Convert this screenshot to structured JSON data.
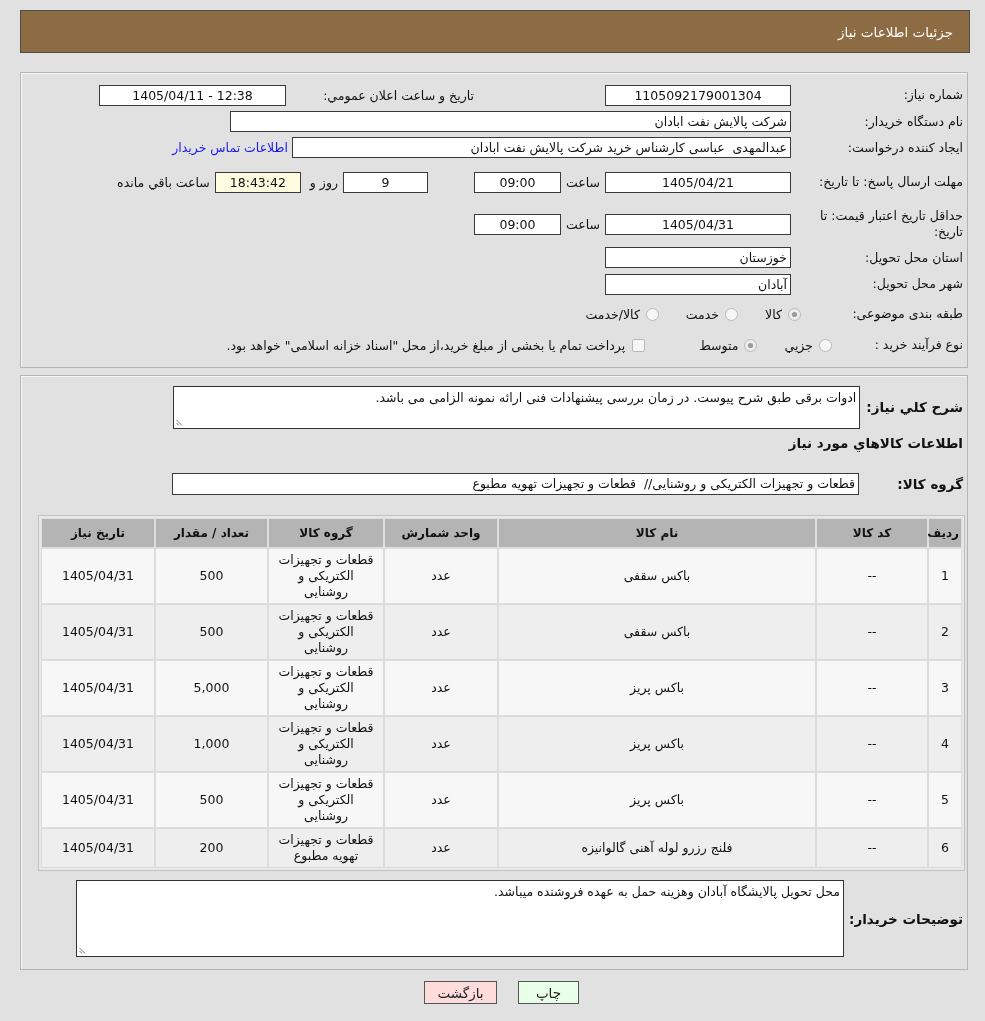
{
  "header": {
    "title": "جزئیات اطلاعات نیاز"
  },
  "details": {
    "need_number": {
      "label": "شماره نیاز:",
      "value": "1105092179001304"
    },
    "announcement": {
      "label": "تاریخ و ساعت اعلان عمومي:",
      "value": "1405/04/11 - 12:38"
    },
    "buyer_org": {
      "label": "نام دستگاه خریدار:",
      "value": "شرکت پالایش نفت ابادان"
    },
    "requester": {
      "label": "ایجاد کننده درخواست:",
      "value": "عبدالمهدی  عباسی کارشناس خرید شرکت پالایش نفت ابادان",
      "contact_link": "اطلاعات تماس خریدار"
    },
    "reply_deadline": {
      "label": "مهلت ارسال پاسخ: تا تاریخ:",
      "date": "1405/04/21",
      "time_label": "ساعت",
      "time": "09:00",
      "days": "9",
      "days_label": "روز و",
      "remaining": "18:43:42",
      "remaining_label": "ساعت باقي مانده"
    },
    "price_validity": {
      "label": "حداقل تاریخ اعتبار قیمت: تا تاریخ:",
      "date": "1405/04/31",
      "time_label": "ساعت",
      "time": "09:00"
    },
    "delivery_province": {
      "label": "استان محل تحویل:",
      "value": "خوزستان"
    },
    "delivery_city": {
      "label": "شهر محل تحویل:",
      "value": "آبادان"
    },
    "category": {
      "label": "طبقه بندی موضوعی:",
      "options": [
        {
          "label": "کالا",
          "selected": true
        },
        {
          "label": "خدمت",
          "selected": false
        },
        {
          "label": "کالا/خدمت",
          "selected": false
        }
      ]
    },
    "purchase_process": {
      "label": "نوع فرآیند خرید :",
      "options": [
        {
          "label": "جزيي",
          "selected": false
        },
        {
          "label": "متوسط",
          "selected": true
        }
      ],
      "treasury_payment": {
        "label": "پرداخت تمام یا بخشی از مبلغ خرید،از محل \"اسناد خزانه اسلامی\" خواهد بود.",
        "checked": false
      }
    }
  },
  "items": {
    "description": {
      "label": "شرح کلي نیاز:",
      "value": "ادوات برقی طبق شرح پیوست. در زمان بررسی پیشنهادات فنی ارائه نمونه الزامی می باشد."
    },
    "section_title": "اطلاعات کالاهاي مورد نیاز",
    "goods_group": {
      "label": "گروه کالا:",
      "value": "قطعات و تجهیزات الکتریکی و روشنایی//  قطعات و تجهیزات تهویه مطبوع"
    },
    "table": {
      "columns": [
        "ردیف",
        "کد کالا",
        "نام کالا",
        "واحد شمارش",
        "گروه کالا",
        "تعداد / مقدار",
        "تاریخ نیاز"
      ],
      "rows": [
        [
          "1",
          "--",
          "باکس سقفی",
          "عدد",
          "قطعات و تجهیزات الکتریکی و روشنایی",
          "500",
          "1405/04/31"
        ],
        [
          "2",
          "--",
          "باکس سقفی",
          "عدد",
          "قطعات و تجهیزات الکتریکی و روشنایی",
          "500",
          "1405/04/31"
        ],
        [
          "3",
          "--",
          "باکس پریز",
          "عدد",
          "قطعات و تجهیزات الکتریکی و روشنایی",
          "5,000",
          "1405/04/31"
        ],
        [
          "4",
          "--",
          "باکس پریز",
          "عدد",
          "قطعات و تجهیزات الکتریکی و روشنایی",
          "1,000",
          "1405/04/31"
        ],
        [
          "5",
          "--",
          "باکس پریز",
          "عدد",
          "قطعات و تجهیزات الکتریکی و روشنایی",
          "500",
          "1405/04/31"
        ],
        [
          "6",
          "--",
          "فلنج رزرو لوله آهنی گالوانیزه",
          "عدد",
          "قطعات و تجهیزات تهویه مطبوع",
          "200",
          "1405/04/31"
        ]
      ]
    },
    "buyer_notes": {
      "label": "توضیحات خریدار:",
      "value": "محل تحویل پالایشگاه آبادان وهزینه حمل به عهده فروشنده میباشد."
    }
  },
  "buttons": [
    {
      "label": "چاپ",
      "kind": "print"
    },
    {
      "label": "بازگشت",
      "kind": "back"
    }
  ]
}
